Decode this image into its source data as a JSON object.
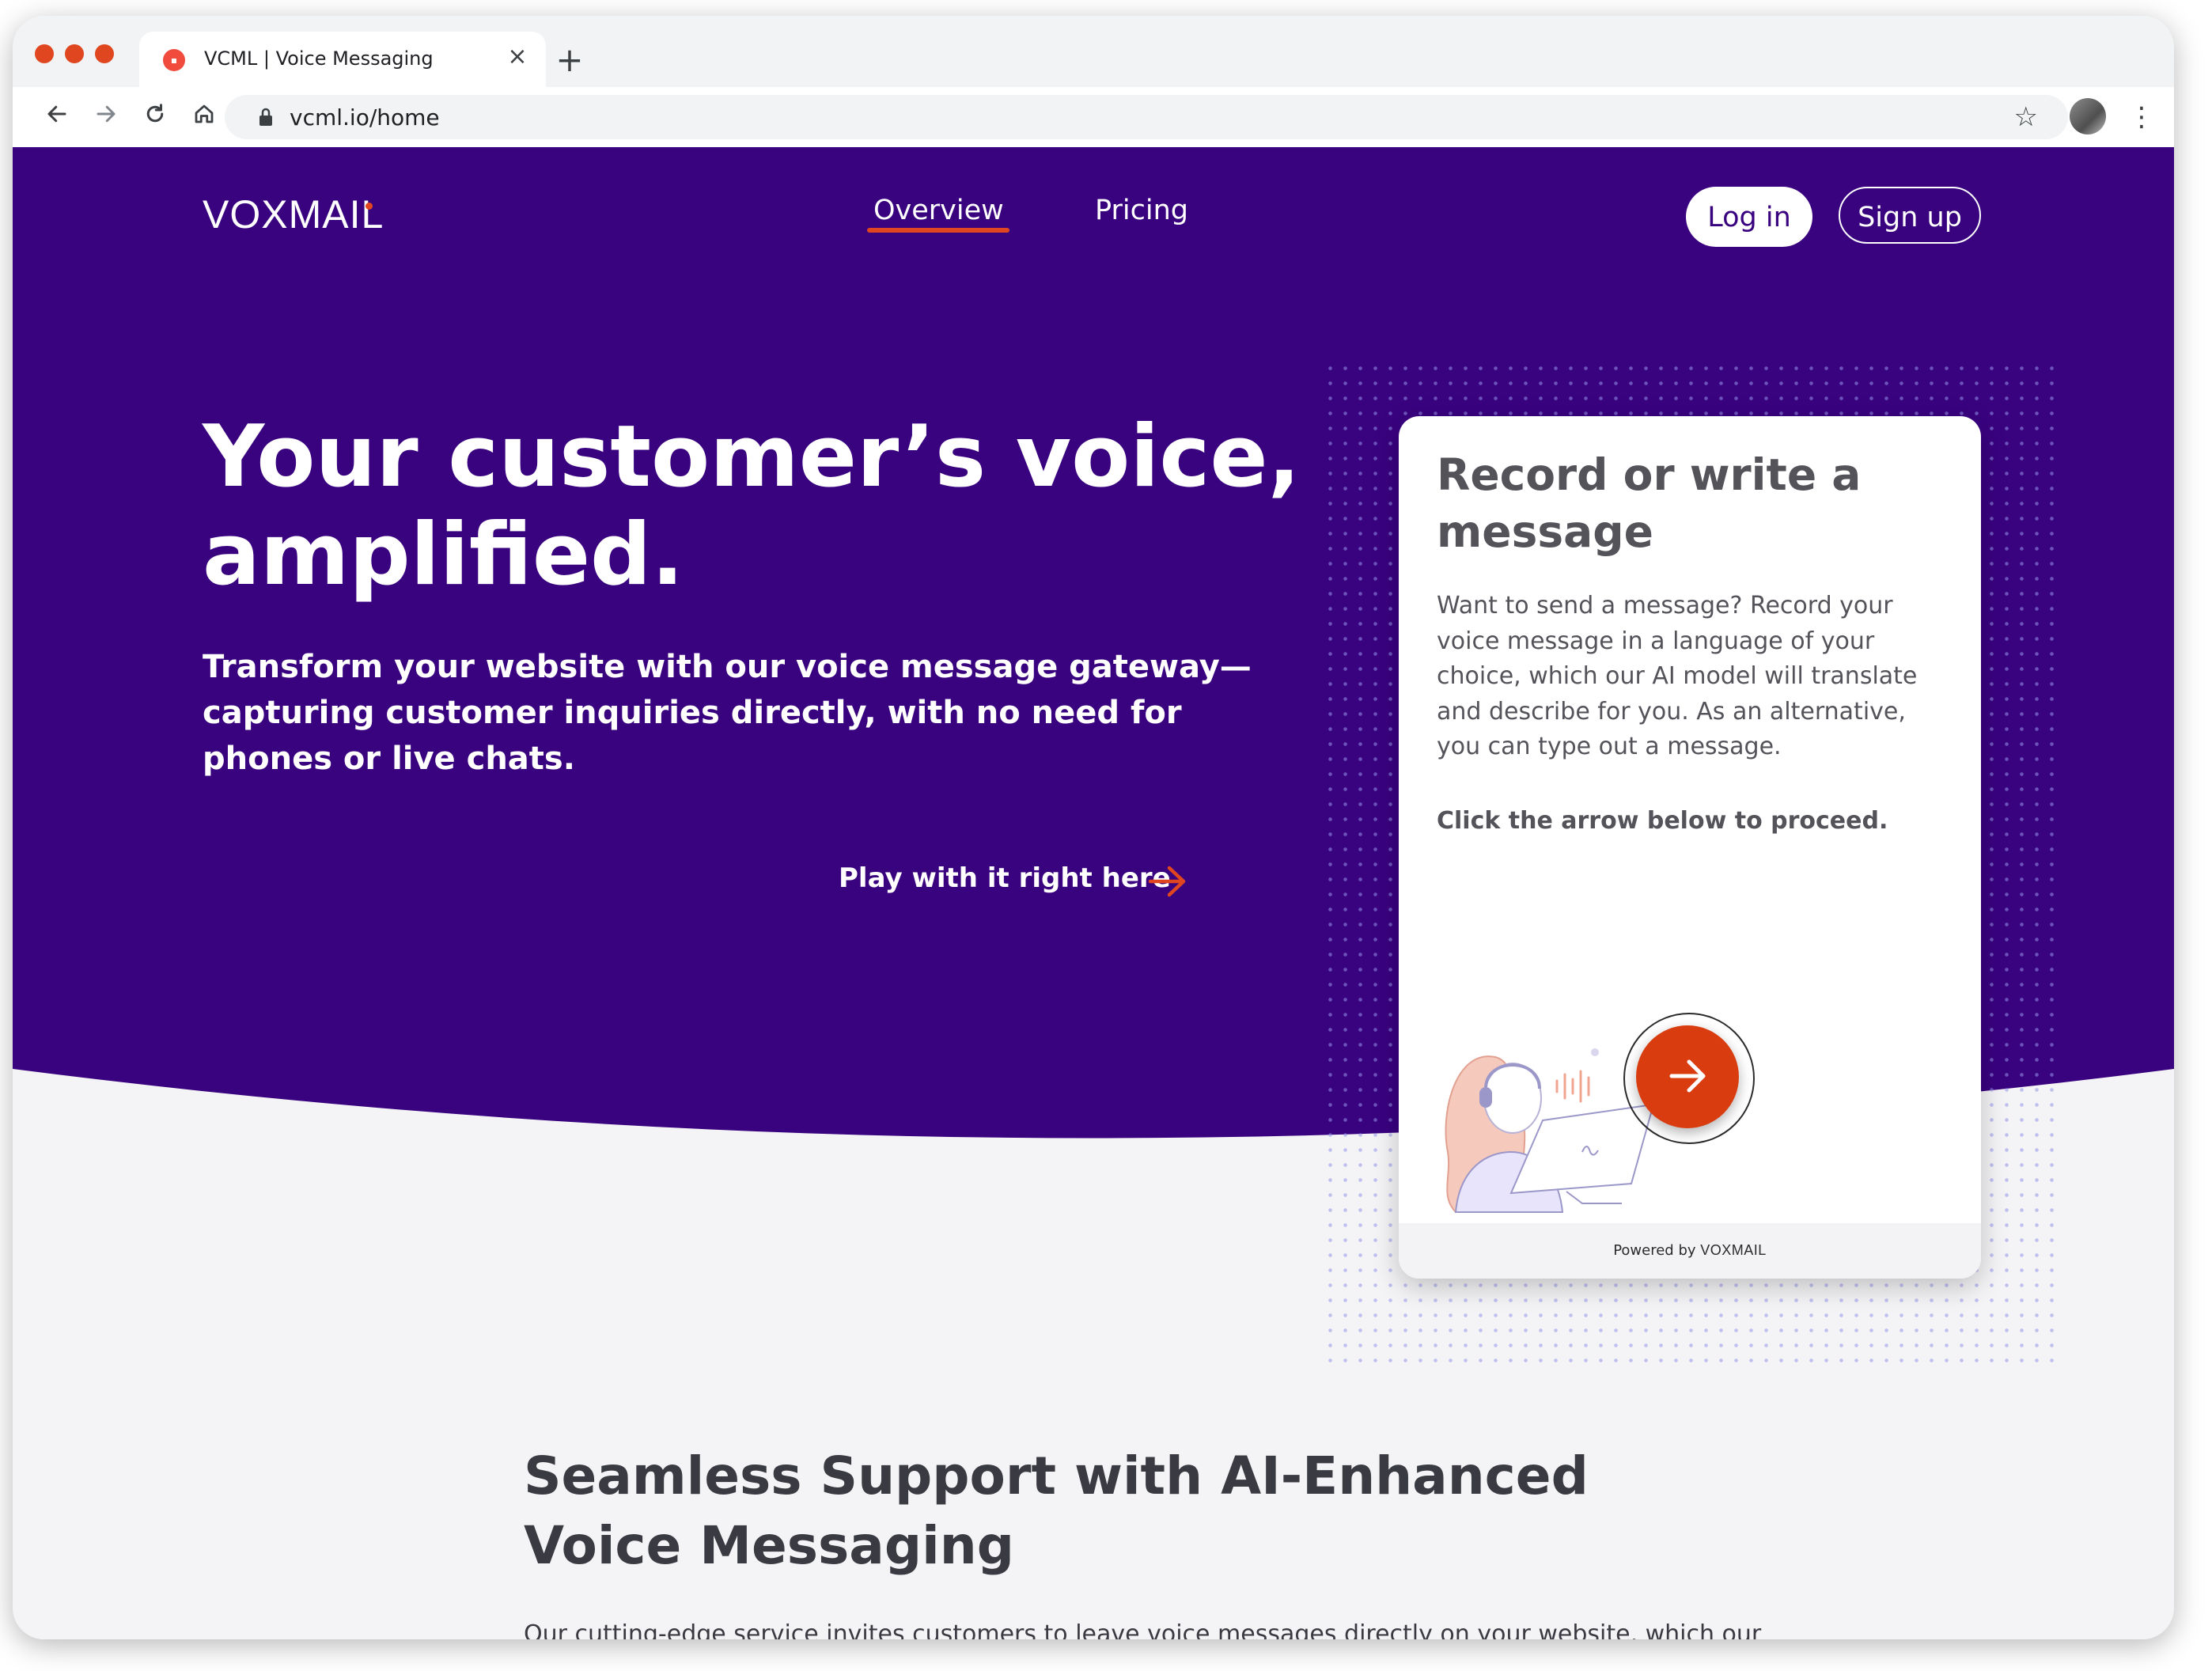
{
  "browser": {
    "tab_title": "VCML | Voice Messaging",
    "url": "vcml.io/home",
    "colors": {
      "close_dot": "#e0461f",
      "min_dot": "#e0461f",
      "max_dot": "#e0461f"
    }
  },
  "nav": {
    "logo": "VOXMAIL",
    "links": [
      {
        "label": "Overview",
        "active": true
      },
      {
        "label": "Pricing",
        "active": false
      }
    ],
    "login_label": "Log in",
    "signup_label": "Sign up"
  },
  "hero": {
    "title": "Your customer’s voice, amplified.",
    "subtitle": "Transform your website with our voice message gateway—capturing customer inquiries directly, with no need for phones or live chats.",
    "cta_label": "Play with it right here",
    "colors": {
      "background": "#39027f",
      "accent": "#e0461f"
    }
  },
  "card": {
    "title": "Record or write a message",
    "body": "Want to send a message? Record your voice message in a language of your choice, which our AI model will translate and describe for you. As an alternative, you can type out a message.",
    "proceed": "Click the arrow below to proceed.",
    "powered_prefix": "Powered by",
    "powered_brand": "VOXMAIL",
    "icon": "arrow-right-icon"
  },
  "section": {
    "title": "Seamless Support with AI-Enhanced Voice Messaging",
    "body": "Our cutting-edge service invites customers to leave voice messages directly on your website, which our"
  }
}
